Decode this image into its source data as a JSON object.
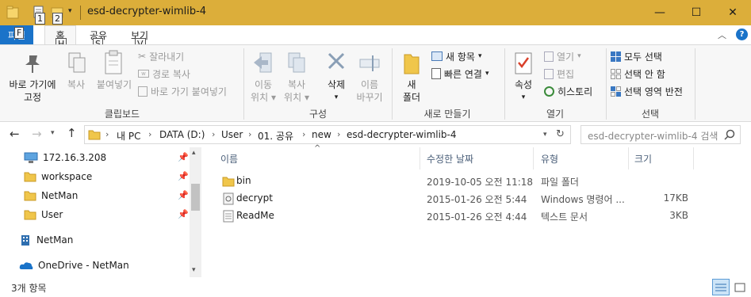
{
  "window": {
    "title": "esd-decrypter-wimlib-4",
    "minimize": "—",
    "maximize": "☐",
    "close": "✕"
  },
  "qat": {
    "keytip_1": "1",
    "keytip_2": "2"
  },
  "tabs": [
    {
      "label": "파일",
      "keytip": "F"
    },
    {
      "label": "홈",
      "keytip": "H"
    },
    {
      "label": "공유",
      "keytip": "S"
    },
    {
      "label": "보기",
      "keytip": "V"
    }
  ],
  "ribbon": {
    "clipboard": {
      "label": "클립보드",
      "pin_line1": "바로 가기에",
      "pin_line2": "고정",
      "copy": "복사",
      "paste": "붙여넣기",
      "cut": "잘라내기",
      "copy_path": "경로 복사",
      "paste_shortcut": "바로 가기 붙여넣기"
    },
    "organize": {
      "label": "구성",
      "move_line1": "이동",
      "move_line2": "위치",
      "copyto_line1": "복사",
      "copyto_line2": "위치",
      "delete": "삭제",
      "rename_line1": "이름",
      "rename_line2": "바꾸기"
    },
    "new": {
      "label": "새로 만들기",
      "folder_line1": "새",
      "folder_line2": "폴더",
      "new_item": "새 항목",
      "easy_access": "빠른 연결"
    },
    "open": {
      "label": "열기",
      "properties": "속성",
      "open": "열기",
      "edit": "편집",
      "history": "히스토리"
    },
    "select": {
      "label": "선택",
      "select_all": "모두 선택",
      "select_none": "선택 안 함",
      "invert": "선택 영역 반전"
    }
  },
  "address": {
    "crumbs": [
      "내 PC",
      "DATA (D:)",
      "User",
      "01. 공유",
      "new",
      "esd-decrypter-wimlib-4"
    ],
    "search_placeholder": "esd-decrypter-wimlib-4 검색"
  },
  "navpane": {
    "items": [
      {
        "label": "172.16.3.208",
        "icon": "network-drive-icon",
        "pinned": true
      },
      {
        "label": "workspace",
        "icon": "folder-icon",
        "pinned": true
      },
      {
        "label": "NetMan",
        "icon": "folder-icon",
        "pinned": true
      },
      {
        "label": "User",
        "icon": "folder-icon",
        "pinned": true
      },
      {
        "label": "NetMan",
        "icon": "building-icon",
        "pinned": false
      },
      {
        "label": "OneDrive - NetMan",
        "icon": "onedrive-icon",
        "pinned": false
      }
    ]
  },
  "list": {
    "headers": [
      "이름",
      "수정한 날짜",
      "유형",
      "크기"
    ],
    "rows": [
      {
        "name": "bin",
        "date": "2019-10-05 오전 11:18",
        "type": "파일 폴더",
        "size": "",
        "icon": "folder-icon"
      },
      {
        "name": "decrypt",
        "date": "2015-01-26 오전 5:44",
        "type": "Windows 명령어 ...",
        "size": "17KB",
        "icon": "batch-file-icon"
      },
      {
        "name": "ReadMe",
        "date": "2015-01-26 오전 4:44",
        "type": "텍스트 문서",
        "size": "3KB",
        "icon": "text-file-icon"
      }
    ]
  },
  "status": {
    "count": "3개 항목"
  },
  "colors": {
    "titlebar": "#dcae3a",
    "folder": "#f0c64b",
    "accent": "#1a73c9"
  }
}
